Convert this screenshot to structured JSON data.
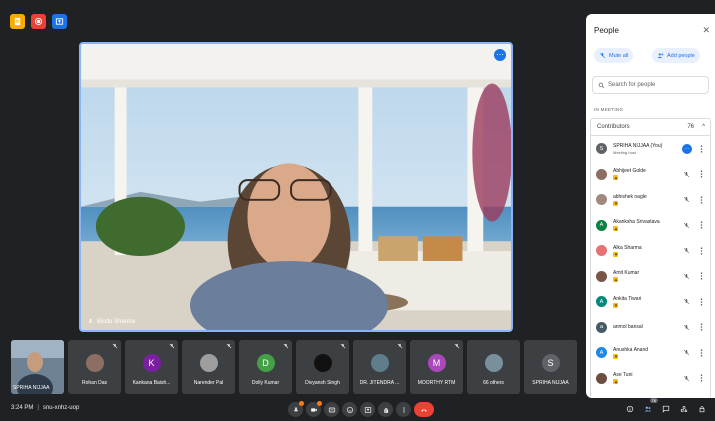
{
  "colors": {
    "background": "#202124",
    "accent_blue": "#1a73e8",
    "end_call_red": "#ea4335",
    "tile_gray": "#3c4043"
  },
  "top_icons": [
    {
      "name": "notes-icon",
      "color": "#f9ab00"
    },
    {
      "name": "record-icon",
      "color": "#ea4335"
    },
    {
      "name": "share-icon",
      "color": "#1a73e8"
    }
  ],
  "main_tile": {
    "name": "Bindu Sharma",
    "more_glyph": "⋯"
  },
  "strip": {
    "self_name": "SPRIHA NIJJAA",
    "tiles": [
      {
        "name": "Rohan Das",
        "initial": "",
        "color": "#8d6e63",
        "icon": "photo"
      },
      {
        "name": "Kankana Baish...",
        "initial": "K",
        "color": "#7b1fa2"
      },
      {
        "name": "Narender Pal",
        "initial": "",
        "color": "#9e9e9e",
        "icon": "photo"
      },
      {
        "name": "Dolly Kumar",
        "initial": "D",
        "color": "#43a047"
      },
      {
        "name": "Divyansh Singh",
        "initial": "",
        "color": "#111111",
        "icon": "photo"
      },
      {
        "name": "DR. JITENDRA ...",
        "initial": "",
        "color": "#607d8b",
        "icon": "photo"
      },
      {
        "name": "MOORTHY RTM",
        "initial": "M",
        "color": "#ab47bc"
      },
      {
        "name": "66 others",
        "initial": "",
        "color": "#78909c",
        "icon": "group"
      },
      {
        "name": "SPRIHA NIJJAA",
        "initial": "S",
        "color": "#5f6368"
      }
    ]
  },
  "bottom": {
    "time": "3:24 PM",
    "separator": "|",
    "meeting_code": "snu-xnhz-uop",
    "people_badge": "76"
  },
  "panel": {
    "title": "People",
    "close": "✕",
    "mute_all": "Mute all",
    "add_people": "Add people",
    "search_placeholder": "Search for people",
    "section": "IN MEETING",
    "contributors_label": "Contributors",
    "contributors_count": "76",
    "chevron": "^",
    "people": [
      {
        "name": "SPRIHA NIJJAA (You)",
        "sub": "Meeting host",
        "initial": "S",
        "color": "#5f6368",
        "host": true
      },
      {
        "name": "Abhijeet Golde",
        "sub": "",
        "initial": "",
        "color": "#8d6e63",
        "hand": true
      },
      {
        "name": "abhishek nagle",
        "sub": "",
        "initial": "",
        "color": "#a1887f",
        "hand": true
      },
      {
        "name": "Akanksha Srivastava",
        "sub": "",
        "initial": "A",
        "color": "#0b8043",
        "hand": true
      },
      {
        "name": "Alka Sharma",
        "sub": "",
        "initial": "",
        "color": "#e57373",
        "hand": true
      },
      {
        "name": "Amit Kumar",
        "sub": "",
        "initial": "",
        "color": "#795548",
        "hand": true
      },
      {
        "name": "Ankita Tiwari",
        "sub": "",
        "initial": "A",
        "color": "#00897b",
        "hand": true
      },
      {
        "name": "anmol bansal",
        "sub": "",
        "initial": "a",
        "color": "#455a64",
        "hand": false
      },
      {
        "name": "Anushka Anand",
        "sub": "",
        "initial": "A",
        "color": "#1e88e5",
        "hand": true
      },
      {
        "name": "Ase Tuni",
        "sub": "",
        "initial": "",
        "color": "#6d4c41",
        "hand": true
      }
    ]
  }
}
